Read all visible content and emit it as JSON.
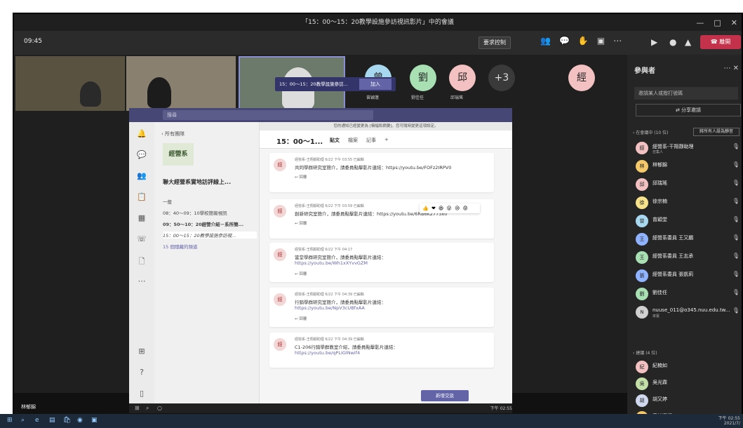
{
  "window": {
    "title": "「15：00～15：20教學設施參訪視訊影片」中的會議",
    "controls": [
      "—",
      "□",
      "✕"
    ]
  },
  "topbar": {
    "timer": "09:45",
    "more_options": "要求控制",
    "icons": [
      "people-icon",
      "chat-icon",
      "raise-hand-icon",
      "layout-icon",
      "more-icon"
    ],
    "leave": "離開"
  },
  "tiles": {
    "avatars": [
      {
        "initial": "曾",
        "name": "曾穎蓮",
        "color": "#a7d8f0"
      },
      {
        "initial": "劉",
        "name": "劉佳任",
        "color": "#a8e0b4"
      },
      {
        "initial": "邱",
        "name": "邱瑞瑤",
        "color": "#f3c1c1"
      },
      {
        "initial": "+3",
        "name": "",
        "color": "#3a3a3a"
      }
    ],
    "right_avatar": "經",
    "sharer": "林郁錦"
  },
  "panel": {
    "title": "參與者",
    "search": "邀請某人或撥打號碼",
    "share": "分享邀請",
    "section_meeting": "› 在會議中 (10 位)",
    "mute_all": "將所有人設為靜音",
    "section_others": "› 建議 (4 位)",
    "people": [
      {
        "initial": "經",
        "name": "經營系-干翔靜助理",
        "sub": "召集人",
        "color": "#f3c1c1"
      },
      {
        "initial": "林",
        "name": "林郁錦",
        "sub": "",
        "color": "#f5c96a"
      },
      {
        "initial": "邱",
        "name": "邱瑞瑤",
        "sub": "",
        "color": "#f3c1c1"
      },
      {
        "initial": "徐",
        "name": "徐宗楠",
        "sub": "",
        "color": "#f5e28a"
      },
      {
        "initial": "曾",
        "name": "曾穎堂",
        "sub": "",
        "color": "#a7d8f0"
      },
      {
        "initial": "王",
        "name": "經營系委員 王又鵬",
        "sub": "",
        "color": "#8fb3ff"
      },
      {
        "initial": "王",
        "name": "經營系委員 王志承",
        "sub": "",
        "color": "#a8e0b4"
      },
      {
        "initial": "張",
        "name": "經營系委員 張凱莉",
        "sub": "",
        "color": "#8fb3ff"
      },
      {
        "initial": "劉",
        "name": "劉佳任",
        "sub": "",
        "color": "#a8e0b4"
      },
      {
        "initial": "N",
        "name": "nuuse_011@o345.nuu.edu.tw...",
        "sub": "來賓",
        "color": "#d0d0d0"
      }
    ],
    "suggested": [
      {
        "initial": "紀",
        "name": "紀楠如",
        "color": "#f3c1c1"
      },
      {
        "initial": "吳",
        "name": "吳光霖",
        "color": "#c4e0a8"
      },
      {
        "initial": "胡",
        "name": "胡又婷",
        "color": "#d0d8f0"
      },
      {
        "initial": "黃",
        "name": "黃林翔揚",
        "color": "#f5c96a"
      }
    ]
  },
  "teams": {
    "search": "搜尋",
    "back": "所有團隊",
    "logo": "經營系",
    "team": "聯大經營系實地訪評線上...",
    "channels": [
      "一般",
      "08：40～09：10學校簡報視訊",
      "09：50～10：20經營介紹－系所簡...",
      "15：00～15：20教學設施參訪視...",
      "15 個隱藏的頻道"
    ],
    "notice": "您的通知已經變更為 [橫幅和摘要]。您可隨時變更這項設定。",
    "channel_title": "15：00～1...",
    "tabs": [
      "貼文",
      "檔案",
      "記事",
      "+"
    ],
    "banner": "15：00～15：20教學設施參訪...",
    "join": "加入",
    "reactions": "👍 ❤ 😆 😮 😢 😡",
    "posts": [
      {
        "meta": "經營系-王翔靜助理  6/22 下午 03:55  已編輯",
        "l1": "共同學群研究室簡介，請委員點擊影片連結：https://youtu.be/FOFz2IRPV0",
        "l2": "",
        "reply": "↩ 回覆"
      },
      {
        "meta": "經營系-王翔靜助理  6/22 下午 03:59  已編輯",
        "l1": "創新研究室簡介，請委員點擊影片連結：https://youtu.be/6RB6K2773x0",
        "l2": "",
        "reply": "↩ 回覆"
      },
      {
        "meta": "經營系-王翔靜助理  6/22 下午 04:17",
        "l1": "當堂學群研究室簡介，請委員點擊影片連結：",
        "l2": "https://youtu.be/Wh1xXYvvGZM",
        "reply": "↩ 回覆"
      },
      {
        "meta": "經營系-王翔靜助理  6/22 下午 04:39  已編輯",
        "l1": "行銷學群研究室簡介，請委員點擊影片連結：",
        "l2": "https://youtu.be/NpV3cUBfxAA",
        "reply": "↩ 回覆"
      },
      {
        "meta": "經營系-王翔靜助理  6/22 下午 04:39  已編輯",
        "l1": "C1-206行銷學群教室介紹，請委員點擊影片連結：",
        "l2": "https://youtu.be/qPLIGlNwif4",
        "reply": ""
      }
    ],
    "new_conv": "新增交談",
    "inner_time": "下午 02:55"
  },
  "taskbar": {
    "time": "下午 02:55",
    "date": "2021/7/"
  }
}
